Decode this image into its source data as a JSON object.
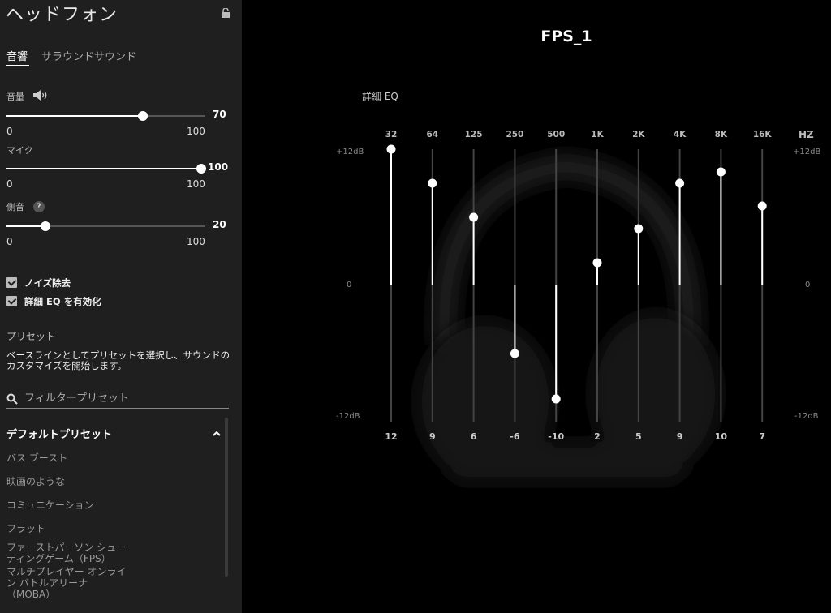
{
  "sidebar": {
    "title": "ヘッドフォン",
    "lock_icon": "unlock-icon",
    "tabs": [
      {
        "label": "音響",
        "active": true
      },
      {
        "label": "サラウンドサウンド",
        "active": false
      }
    ],
    "sliders": {
      "volume": {
        "label": "音量",
        "value": 70,
        "value_text": "70",
        "min": "0",
        "max": "100"
      },
      "mic": {
        "label": "マイク",
        "value": 100,
        "value_text": "100",
        "min": "0",
        "max": "100"
      },
      "sidetone": {
        "label": "側音",
        "value": 20,
        "value_text": "20",
        "min": "0",
        "max": "100"
      }
    },
    "help_icon_text": "?",
    "checkboxes": {
      "noise": {
        "label": "ノイズ除去",
        "checked": true
      },
      "advanced_eq": {
        "label": "詳細 EQ を有効化",
        "checked": true
      }
    },
    "preset_heading": "プリセット",
    "preset_desc": "ベースラインとしてプリセットを選択し、サウンドのカスタマイズを開始します。",
    "search": {
      "placeholder": "フィルタープリセット"
    },
    "group_title": "デフォルトプリセット",
    "presets": [
      "バス ブースト",
      "映画のような",
      "コミュニケーション",
      "フラット",
      "ファーストパーソン シューティングゲーム（FPS）",
      "マルチプレイヤー オンライン バトルアリーナ（MOBA）"
    ]
  },
  "main": {
    "preset_name": "FPS_1",
    "eq_title": "詳細 EQ",
    "hz_label": "HZ",
    "axis": {
      "top": "+12dB",
      "mid": "0",
      "bottom": "-12dB"
    },
    "accent": "#ffffff"
  },
  "chart_data": {
    "type": "bar",
    "title": "詳細 EQ",
    "xlabel": "HZ",
    "ylabel": "",
    "ylim": [
      -12,
      12
    ],
    "categories": [
      "32",
      "64",
      "125",
      "250",
      "500",
      "1K",
      "2K",
      "4K",
      "8K",
      "16K"
    ],
    "values": [
      12,
      9,
      6,
      -6,
      -10,
      2,
      5,
      9,
      10,
      7
    ],
    "value_labels": [
      "12",
      "9",
      "6",
      "-6",
      "-10",
      "2",
      "5",
      "9",
      "10",
      "7"
    ],
    "y_tick_labels": [
      "+12dB",
      "0",
      "-12dB"
    ]
  }
}
